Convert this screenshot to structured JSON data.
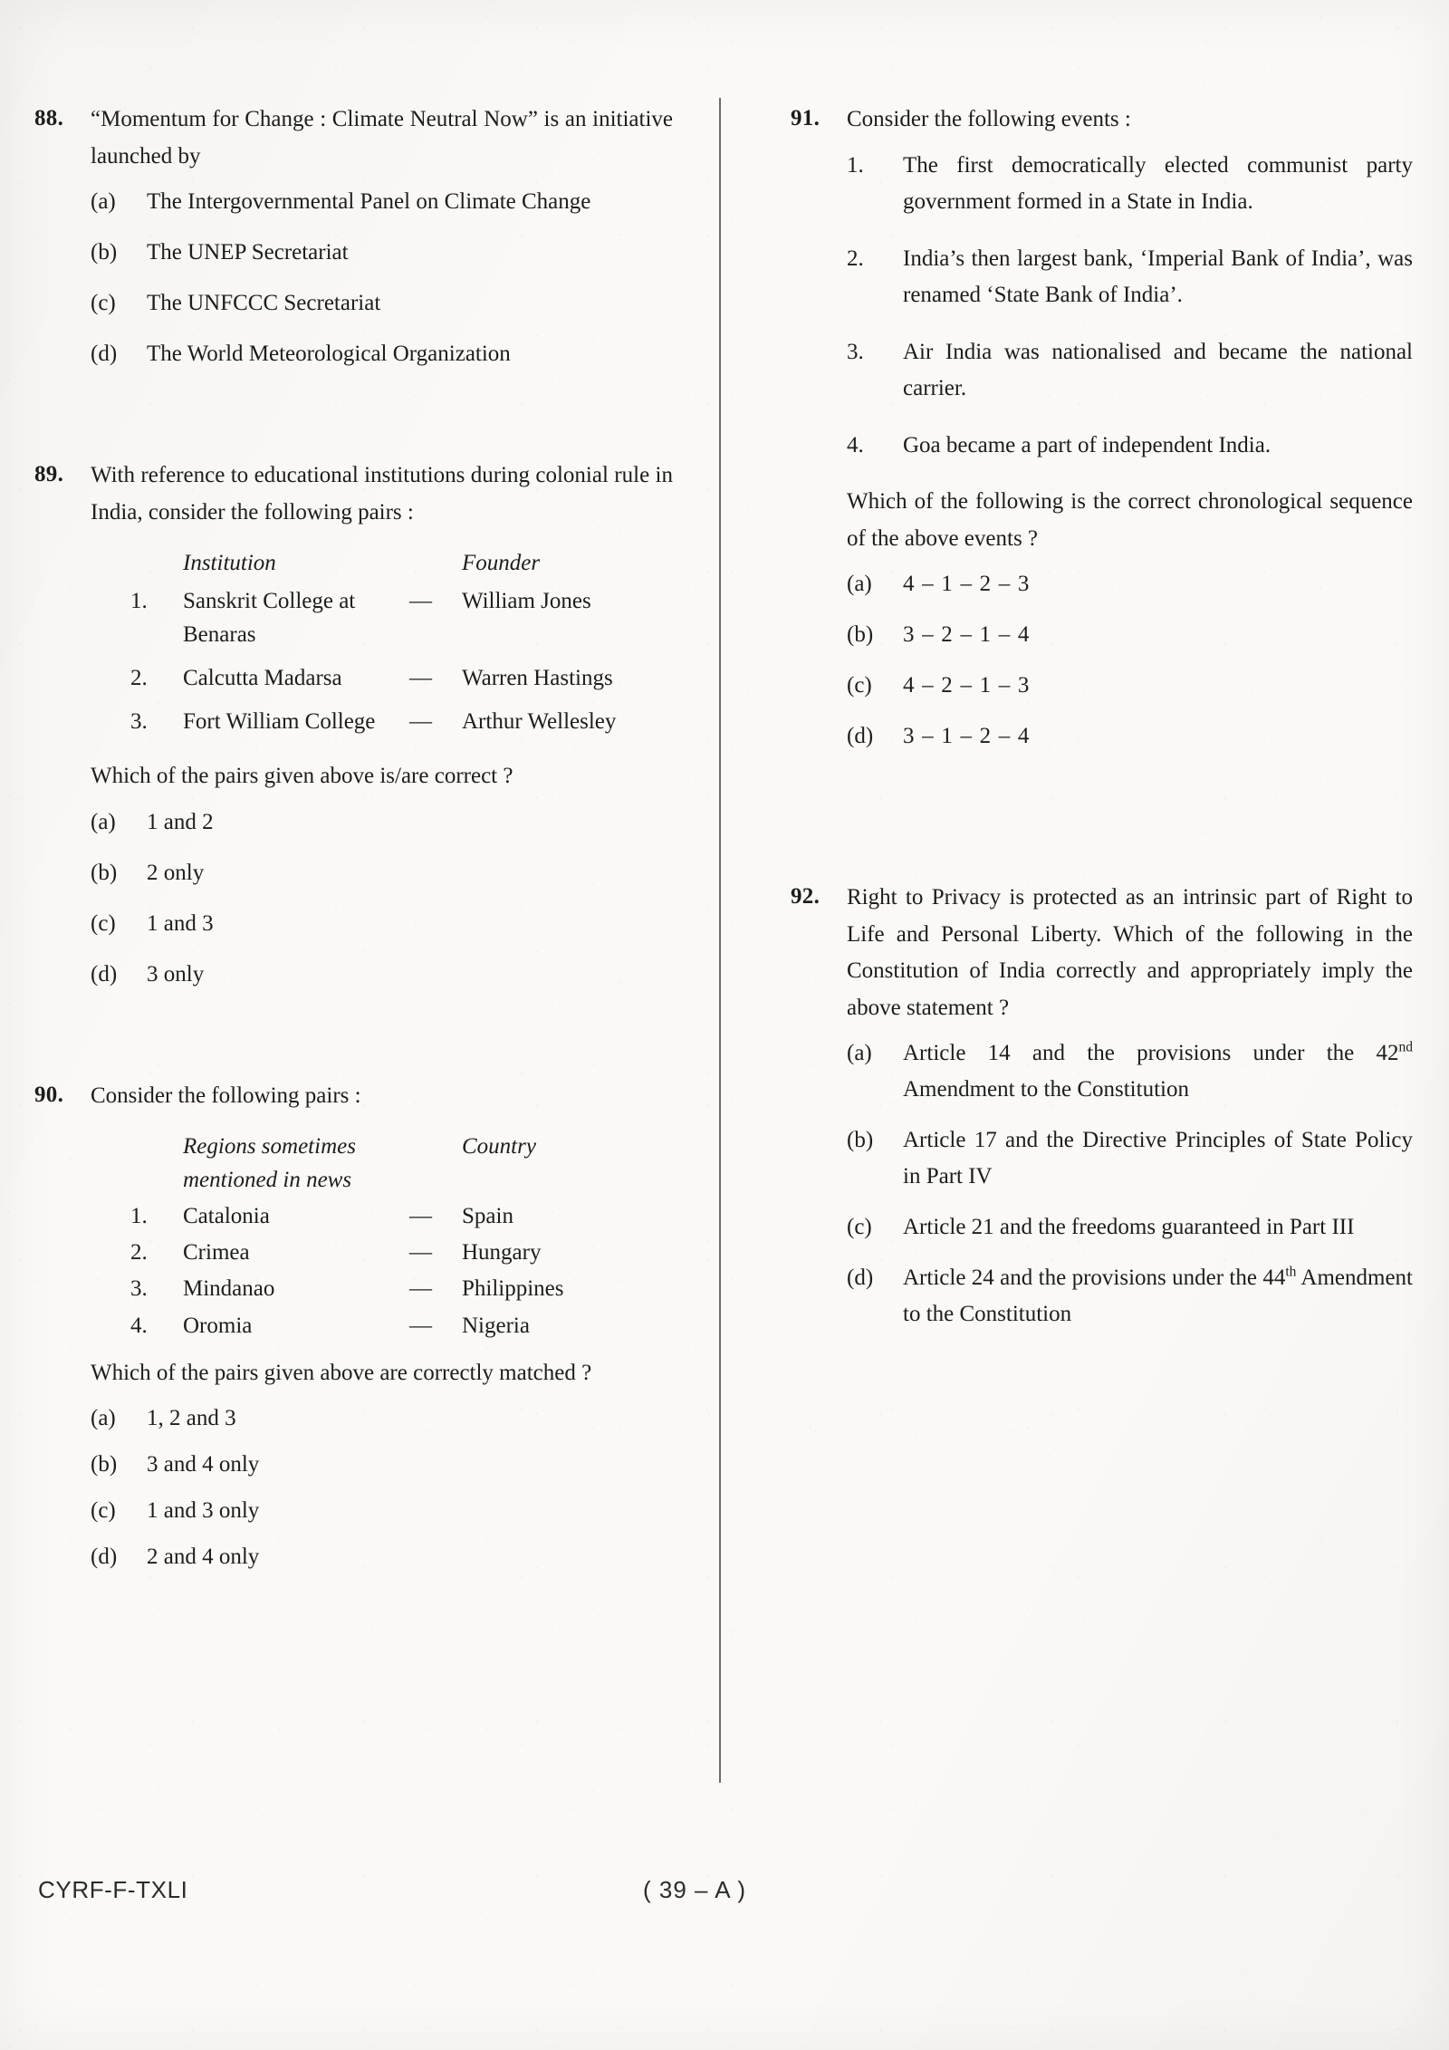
{
  "document": {
    "footer_code": "CYRF-F-TXLI",
    "footer_page": "( 39 – A )"
  },
  "questions": [
    {
      "number": "88.",
      "stem": "“Momentum for Change : Climate Neutral Now” is an initiative launched by",
      "options": [
        {
          "key": "(a)",
          "text": "The Intergovernmental Panel on Climate Change"
        },
        {
          "key": "(b)",
          "text": "The UNEP Secretariat"
        },
        {
          "key": "(c)",
          "text": "The UNFCCC Secretariat"
        },
        {
          "key": "(d)",
          "text": "The World Meteorological Organization"
        }
      ]
    },
    {
      "number": "89.",
      "stem": "With reference to educational institutions during colonial rule in India, consider the following pairs :",
      "table": {
        "header_left": "Institution",
        "header_right": "Founder",
        "rows": [
          {
            "num": "1.",
            "left": "Sanskrit College at Benaras",
            "dash": "—",
            "right": "William Jones"
          },
          {
            "num": "2.",
            "left": "Calcutta Madarsa",
            "dash": "—",
            "right": "Warren Hastings"
          },
          {
            "num": "3.",
            "left": "Fort William College",
            "dash": "—",
            "right": "Arthur Wellesley"
          }
        ]
      },
      "sub_stem": "Which of the pairs given above is/are correct ?",
      "options": [
        {
          "key": "(a)",
          "text": "1 and 2"
        },
        {
          "key": "(b)",
          "text": "2 only"
        },
        {
          "key": "(c)",
          "text": "1 and 3"
        },
        {
          "key": "(d)",
          "text": "3 only"
        }
      ]
    },
    {
      "number": "90.",
      "stem": "Consider the following pairs :",
      "table": {
        "header_left": "Regions sometimes mentioned in news",
        "header_right": "Country",
        "rows": [
          {
            "num": "1.",
            "left": "Catalonia",
            "dash": "—",
            "right": "Spain"
          },
          {
            "num": "2.",
            "left": "Crimea",
            "dash": "—",
            "right": "Hungary"
          },
          {
            "num": "3.",
            "left": "Mindanao",
            "dash": "—",
            "right": "Philippines"
          },
          {
            "num": "4.",
            "left": "Oromia",
            "dash": "—",
            "right": "Nigeria"
          }
        ]
      },
      "sub_stem": "Which of the pairs given above are correctly matched ?",
      "options": [
        {
          "key": "(a)",
          "text": "1, 2 and 3"
        },
        {
          "key": "(b)",
          "text": "3 and 4 only"
        },
        {
          "key": "(c)",
          "text": "1 and 3 only"
        },
        {
          "key": "(d)",
          "text": "2 and 4 only"
        }
      ]
    },
    {
      "number": "91.",
      "stem": "Consider the following events :",
      "statements": [
        {
          "num": "1.",
          "text": "The first democratically elected communist party government formed in a State in India."
        },
        {
          "num": "2.",
          "text": "India’s then largest bank, ‘Imperial Bank of India’, was renamed ‘State Bank of India’."
        },
        {
          "num": "3.",
          "text": "Air India was nationalised and became the national carrier."
        },
        {
          "num": "4.",
          "text": "Goa became a part of independent India."
        }
      ],
      "sub_stem": "Which of the following is the correct chronological sequence of the above events ?",
      "options": [
        {
          "key": "(a)",
          "text": "4 – 1 – 2 – 3"
        },
        {
          "key": "(b)",
          "text": "3 – 2 – 1 – 4"
        },
        {
          "key": "(c)",
          "text": "4 – 2 – 1 – 3"
        },
        {
          "key": "(d)",
          "text": "3 – 1 – 2 – 4"
        }
      ]
    },
    {
      "number": "92.",
      "stem": "Right to Privacy is protected as an intrinsic part of Right to Life and Personal Liberty. Which of the following in the Constitution of India correctly and appropriately imply the above statement ?",
      "options": [
        {
          "key": "(a)",
          "text_before": "Article 14 and the provisions under the 42",
          "sup": "nd",
          "text_after": " Amendment to the Constitution"
        },
        {
          "key": "(b)",
          "text": "Article 17 and the Directive Principles of State Policy in Part IV"
        },
        {
          "key": "(c)",
          "text": "Article 21 and the freedoms guaranteed in Part III"
        },
        {
          "key": "(d)",
          "text_before": "Article 24 and the provisions under the 44",
          "sup": "th",
          "text_after": " Amendment to the Constitution"
        }
      ]
    }
  ]
}
